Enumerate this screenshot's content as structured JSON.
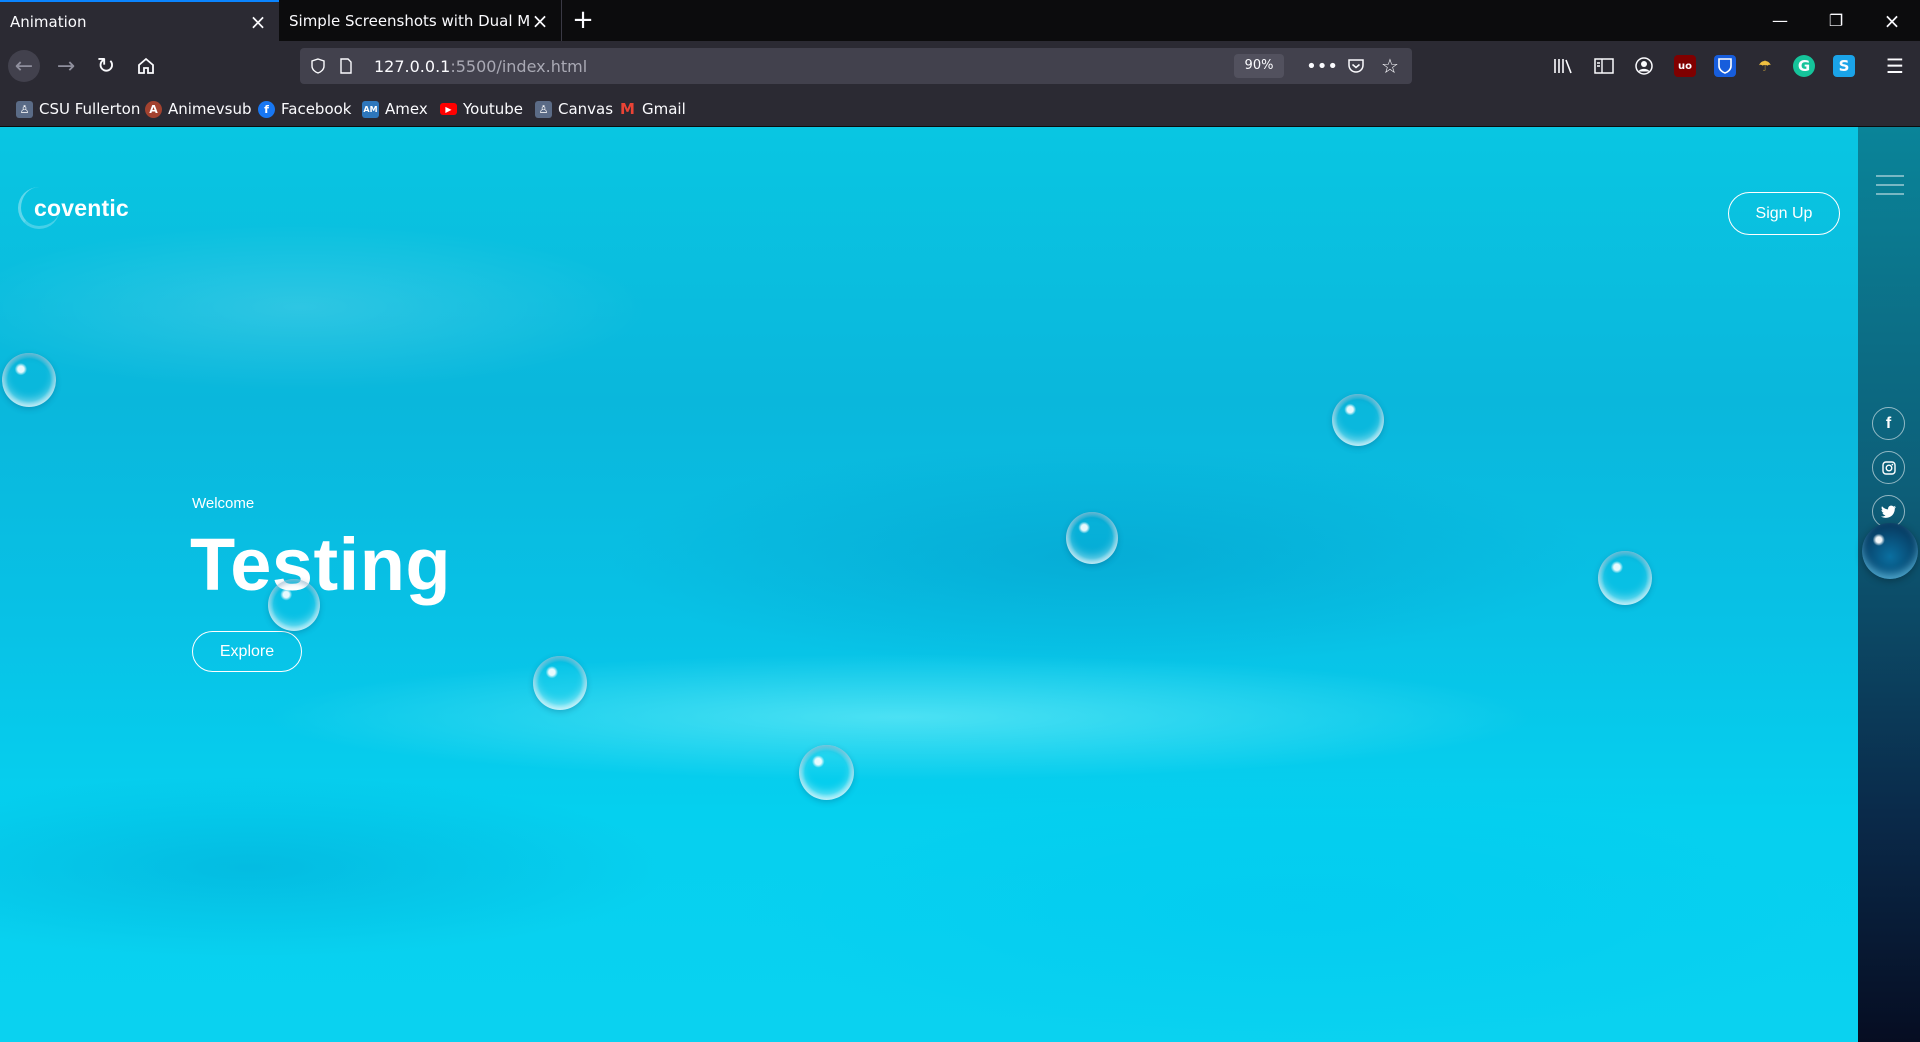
{
  "browser": {
    "tabs": [
      {
        "label": "Animation"
      },
      {
        "label": "Simple Screenshots with Dual Moni"
      }
    ],
    "url_host": "127.0.0.1",
    "url_path": ":5500/index.html",
    "zoom": "90%",
    "bookmarks": [
      {
        "label": "CSU Fullerton",
        "icon": "csuf-icon",
        "color": "#5a6b86"
      },
      {
        "label": "Animevsub",
        "icon": "animevsub-icon",
        "color": "#a3422f"
      },
      {
        "label": "Facebook",
        "icon": "facebook-icon",
        "color": "#1877f2"
      },
      {
        "label": "Amex",
        "icon": "amex-icon",
        "color": "#2e77bc"
      },
      {
        "label": "Youtube",
        "icon": "youtube-icon",
        "color": "#ff0000"
      },
      {
        "label": "Canvas",
        "icon": "canvas-icon",
        "color": "#5b6b86"
      },
      {
        "label": "Gmail",
        "icon": "gmail-icon",
        "color": "#ea4335"
      }
    ]
  },
  "site": {
    "logo": "coventic",
    "signup_label": "Sign Up",
    "welcome": "Welcome",
    "headline": "Testing",
    "explore_label": "Explore",
    "social": [
      "facebook",
      "instagram",
      "twitter"
    ]
  },
  "colors": {
    "accent": "#0a84ff",
    "page_cyan": "#09c6e2",
    "rail_top": "#0a8499",
    "rail_bottom": "#060d22"
  }
}
